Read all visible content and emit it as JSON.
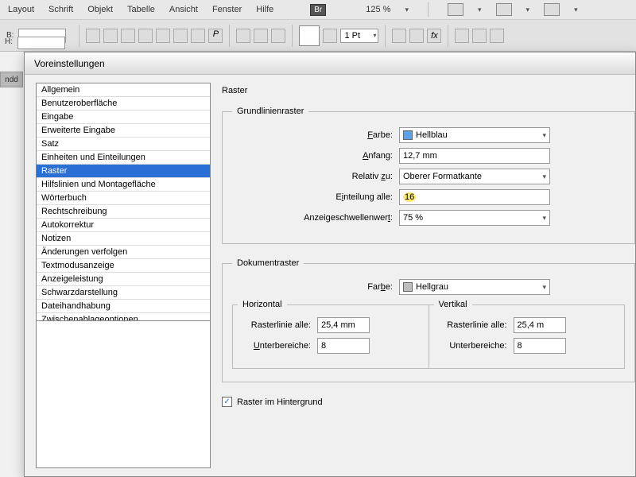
{
  "menubar": {
    "items": [
      "Layout",
      "Schrift",
      "Objekt",
      "Tabelle",
      "Ansicht",
      "Fenster",
      "Hilfe"
    ],
    "bridge": "Br",
    "zoom": "125 %"
  },
  "toolbar": {
    "b_label": "B:",
    "h_label": "H:",
    "stroke_weight": "1 Pt"
  },
  "doctab": "ndd",
  "dialog": {
    "title": "Voreinstellungen",
    "categories": [
      "Allgemein",
      "Benutzeroberfläche",
      "Eingabe",
      "Erweiterte Eingabe",
      "Satz",
      "Einheiten und Einteilungen",
      "Raster",
      "Hilfslinien und Montagefläche",
      "Wörterbuch",
      "Rechtschreibung",
      "Autokorrektur",
      "Notizen",
      "Änderungen verfolgen",
      "Textmodusanzeige",
      "Anzeigeleistung",
      "Schwarzdarstellung",
      "Dateihandhabung",
      "Zwischenablageoptionen"
    ],
    "selected_index": 6,
    "heading": "Raster",
    "baseline": {
      "legend": "Grundlinienraster",
      "color_label": "Farbe:",
      "color_value": "Hellblau",
      "start_label": "Anfang:",
      "start_value": "12,7 mm",
      "relative_label": "Relativ zu:",
      "relative_value": "Oberer Formatkante",
      "increment_label": "Einteilung alle:",
      "increment_value": "16",
      "threshold_label": "Anzeigeschwellenwert:",
      "threshold_value": "75 %"
    },
    "document": {
      "legend": "Dokumentraster",
      "color_label": "Farbe:",
      "color_value": "Hellgrau",
      "horizontal": {
        "legend": "Horizontal",
        "gridline_label": "Rasterlinie alle:",
        "gridline_value": "25,4 mm",
        "subdiv_label": "Unterbereiche:",
        "subdiv_value": "8"
      },
      "vertical": {
        "legend": "Vertikal",
        "gridline_label": "Rasterlinie alle:",
        "gridline_value": "25,4 m",
        "subdiv_label": "Unterbereiche:",
        "subdiv_value": "8"
      }
    },
    "grid_back_label": "Raster im Hintergrund",
    "grid_back_checked": true
  }
}
